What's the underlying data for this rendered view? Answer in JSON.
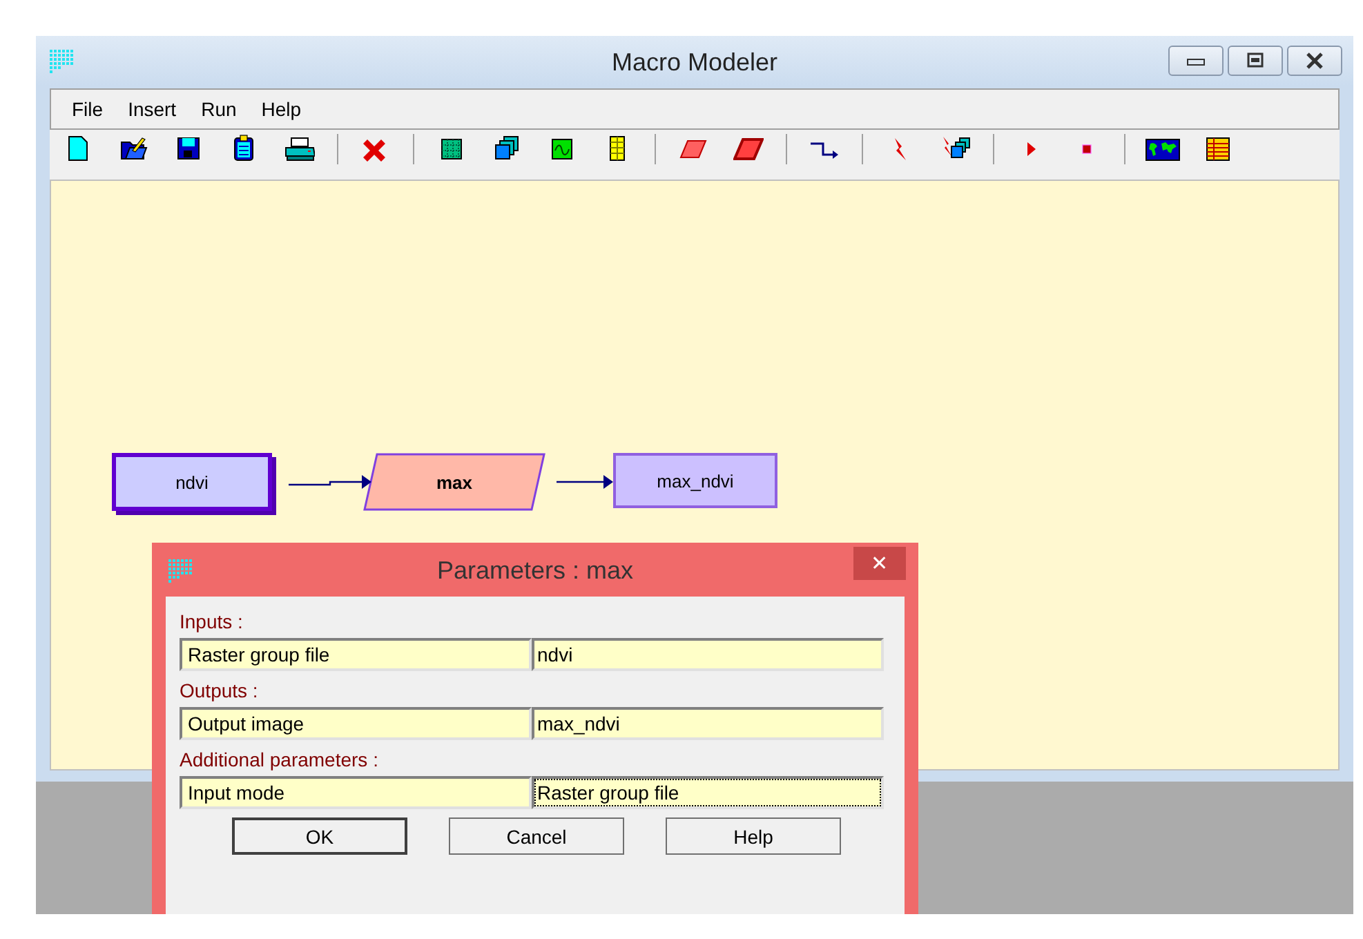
{
  "window": {
    "title": "Macro Modeler"
  },
  "menu": [
    "File",
    "Insert",
    "Run",
    "Help"
  ],
  "toolbar": [
    [
      {
        "kind": "new-file"
      },
      {
        "kind": "open-folder"
      },
      {
        "kind": "save"
      },
      {
        "kind": "clipboard"
      },
      {
        "kind": "printer"
      }
    ],
    [
      {
        "kind": "delete"
      }
    ],
    [
      {
        "kind": "raster"
      },
      {
        "kind": "raster-group"
      },
      {
        "kind": "vector"
      },
      {
        "kind": "values-file"
      }
    ],
    [
      {
        "kind": "module"
      },
      {
        "kind": "submodel"
      }
    ],
    [
      {
        "kind": "connector"
      }
    ],
    [
      {
        "kind": "link"
      },
      {
        "kind": "link-group"
      }
    ],
    [
      {
        "kind": "run"
      },
      {
        "kind": "stop"
      }
    ],
    [
      {
        "kind": "map"
      },
      {
        "kind": "table"
      }
    ]
  ],
  "canvas": {
    "nodes": [
      {
        "label": "ndvi",
        "kind": "group-file"
      },
      {
        "label": "max",
        "kind": "module"
      },
      {
        "label": "max_ndvi",
        "kind": "image"
      }
    ]
  },
  "dialog": {
    "title": "Parameters : max",
    "close": "✕",
    "sections": [
      {
        "heading": "Inputs :",
        "rows": [
          {
            "name": "Raster group file",
            "value": "ndvi",
            "focused": false
          }
        ]
      },
      {
        "heading": "Outputs :",
        "rows": [
          {
            "name": "Output image",
            "value": "max_ndvi",
            "focused": false
          }
        ]
      },
      {
        "heading": "Additional parameters :",
        "rows": [
          {
            "name": "Input mode",
            "value": "Raster group file",
            "focused": true
          }
        ]
      }
    ],
    "buttons": [
      {
        "label": "OK",
        "default": true
      },
      {
        "label": "Cancel",
        "default": false
      },
      {
        "label": "Help",
        "default": false
      }
    ]
  }
}
